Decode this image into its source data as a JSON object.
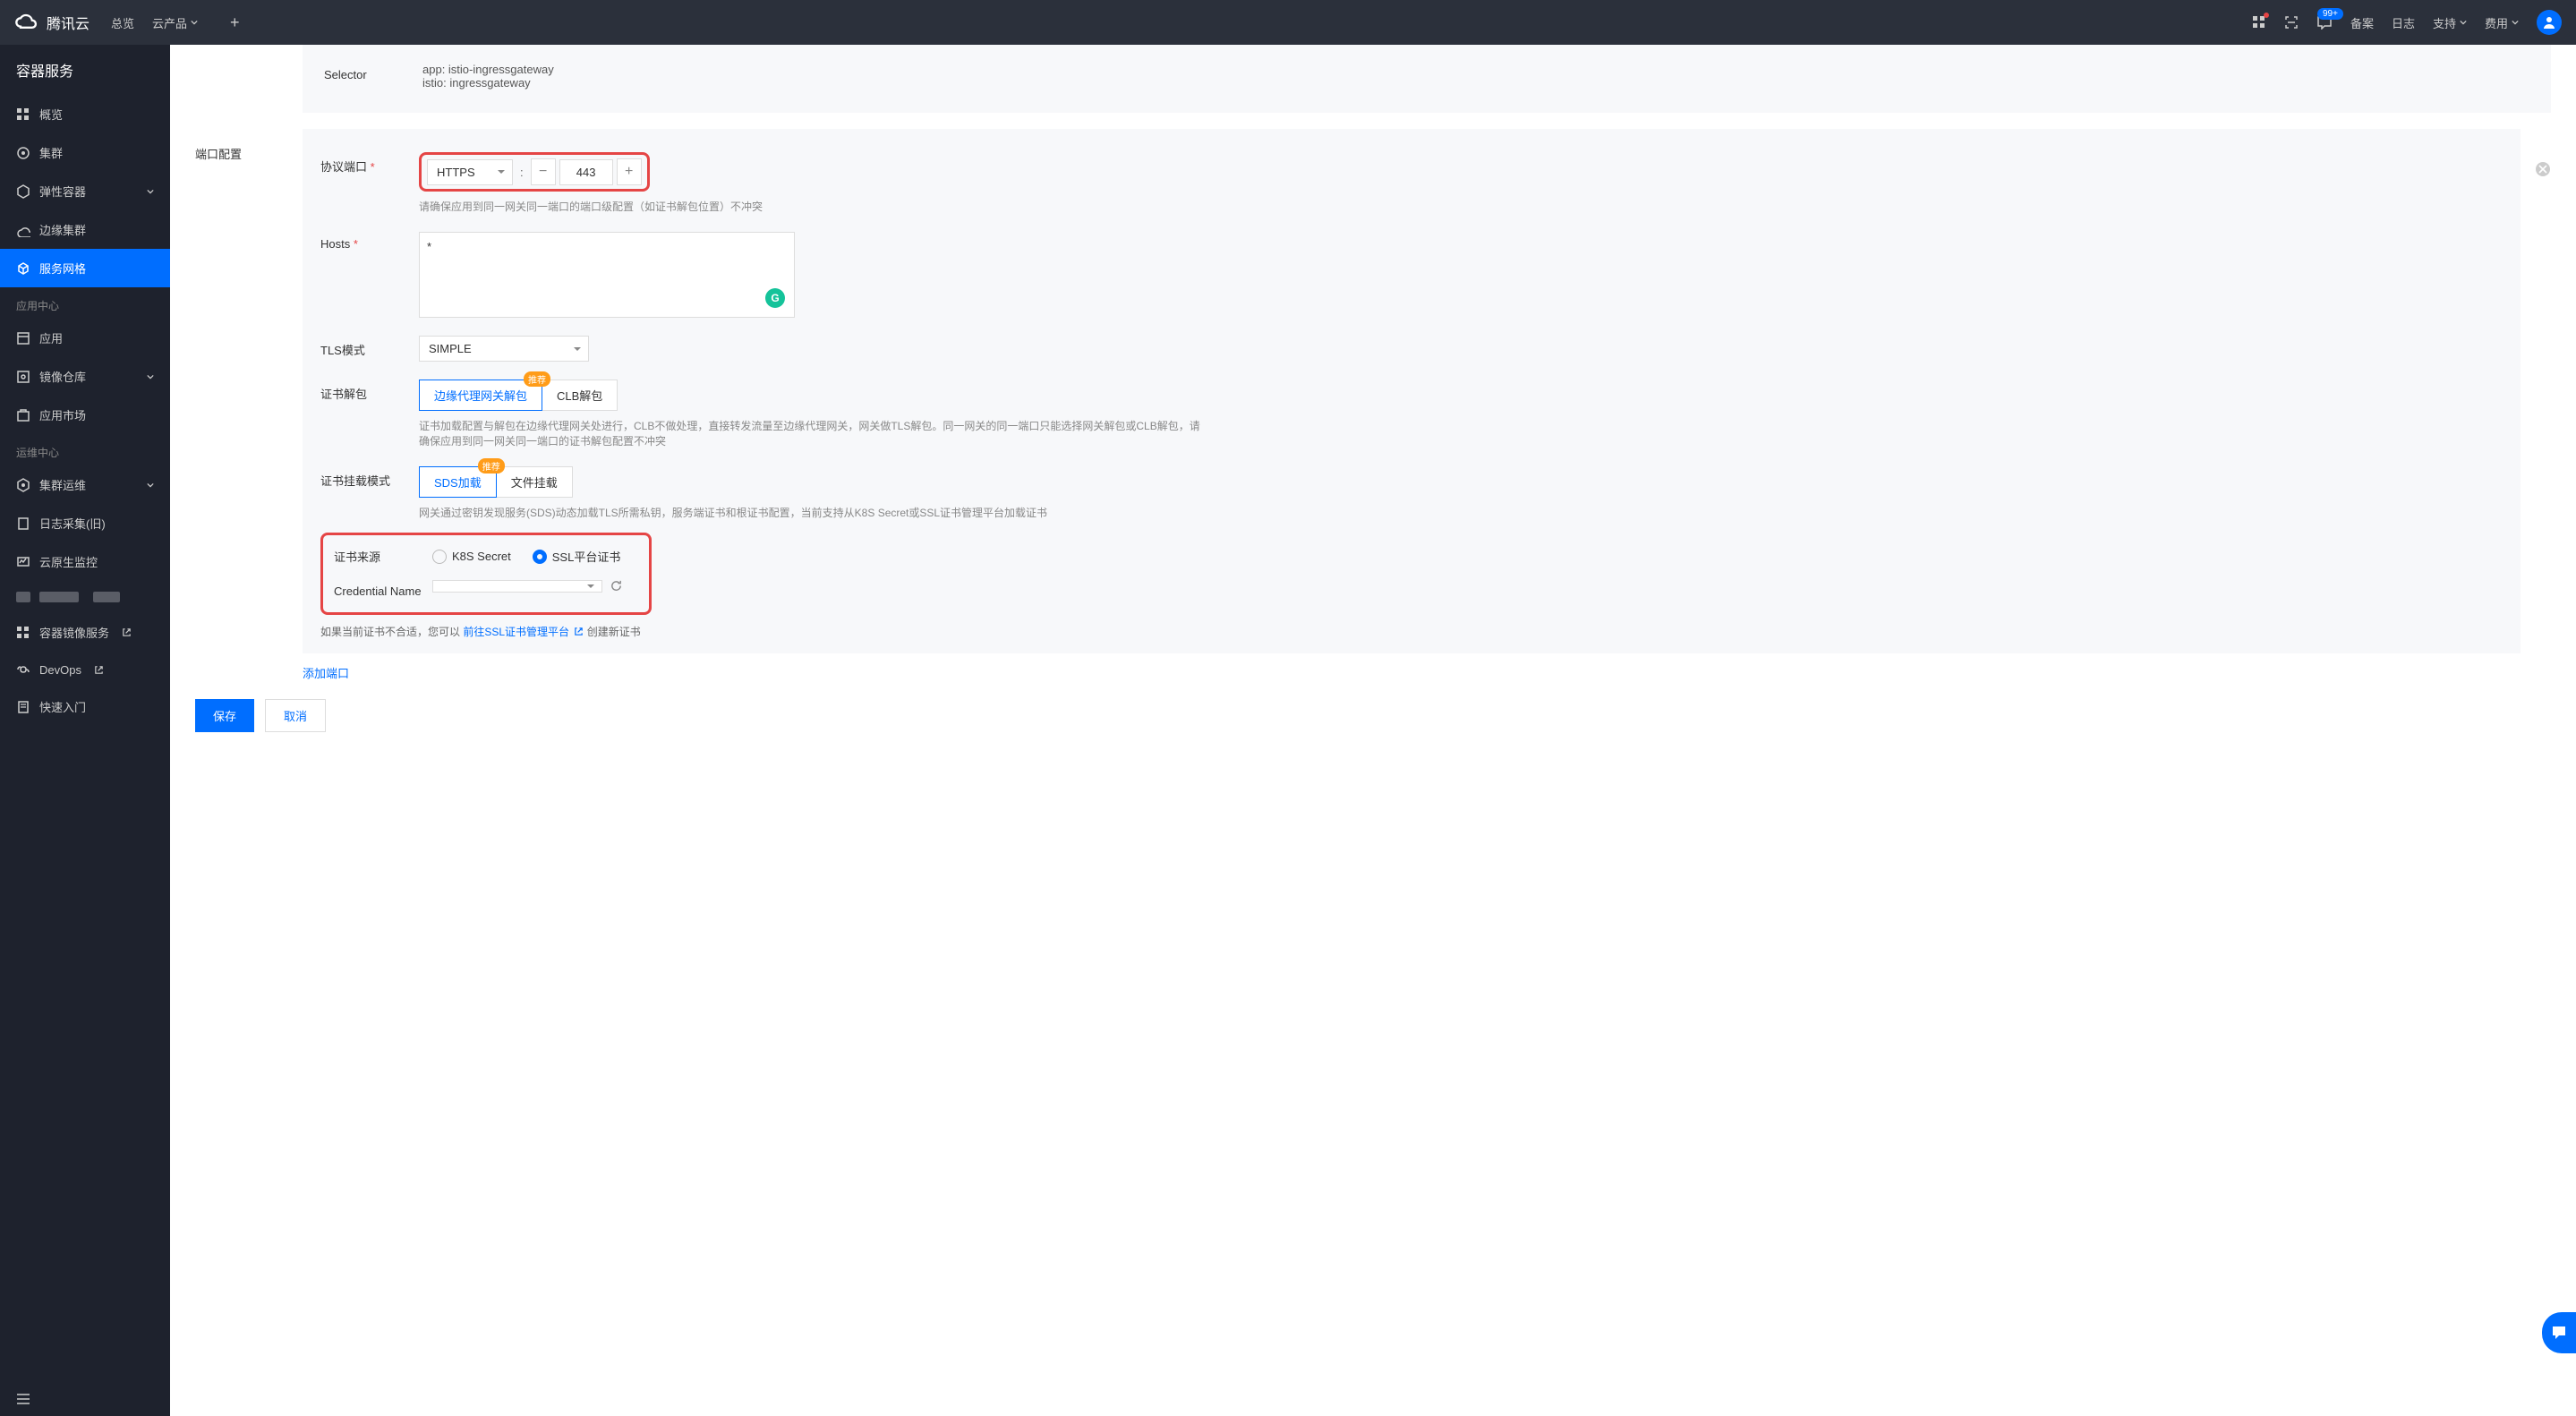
{
  "header": {
    "brand": "腾讯云",
    "nav": {
      "overview": "总览",
      "products": "云产品"
    },
    "badge_99": "99+",
    "right": {
      "beian": "备案",
      "log": "日志",
      "support": "支持",
      "cost": "费用"
    }
  },
  "sidebar": {
    "title": "容器服务",
    "items": {
      "overview": "概览",
      "cluster": "集群",
      "elastic": "弹性容器",
      "edge": "边缘集群",
      "mesh": "服务网格"
    },
    "section_app": "应用中心",
    "app_items": {
      "app": "应用",
      "image_repo": "镜像仓库",
      "app_market": "应用市场"
    },
    "section_ops": "运维中心",
    "ops_items": {
      "cluster_ops": "集群运维",
      "log_collect": "日志采集(旧)",
      "cloud_monitor": "云原生监控",
      "image_service": "容器镜像服务",
      "devops": "DevOps",
      "quickstart": "快速入门"
    }
  },
  "form": {
    "selector": {
      "label": "Selector",
      "line1": "app: istio-ingressgateway",
      "line2": "istio: ingressgateway"
    },
    "port_config_label": "端口配置",
    "protocol_port": {
      "label": "协议端口",
      "protocol": "HTTPS",
      "colon": ":",
      "port": "443",
      "hint": "请确保应用到同一网关同一端口的端口级配置（如证书解包位置）不冲突"
    },
    "hosts": {
      "label": "Hosts",
      "value": "*"
    },
    "tls_mode": {
      "label": "TLS模式",
      "value": "SIMPLE"
    },
    "cert_unpack": {
      "label": "证书解包",
      "opt1": "边缘代理网关解包",
      "opt2": "CLB解包",
      "badge": "推荐",
      "hint": "证书加载配置与解包在边缘代理网关处进行，CLB不做处理，直接转发流量至边缘代理网关，网关做TLS解包。同一网关的同一端口只能选择网关解包或CLB解包，请确保应用到同一网关同一端口的证书解包配置不冲突"
    },
    "cert_mount": {
      "label": "证书挂载模式",
      "opt1": "SDS加载",
      "opt2": "文件挂载",
      "badge": "推荐",
      "hint": "网关通过密钥发现服务(SDS)动态加载TLS所需私钥，服务端证书和根证书配置，当前支持从K8S Secret或SSL证书管理平台加载证书"
    },
    "cert_source": {
      "label": "证书来源",
      "opt1": "K8S Secret",
      "opt2": "SSL平台证书"
    },
    "credential": {
      "label": "Credential Name",
      "value": ""
    },
    "ssl_hint": {
      "prefix": "如果当前证书不合适，您可以",
      "link": "前往SSL证书管理平台",
      "suffix": " 创建新证书"
    },
    "add_port": "添加端口",
    "save": "保存",
    "cancel": "取消"
  }
}
